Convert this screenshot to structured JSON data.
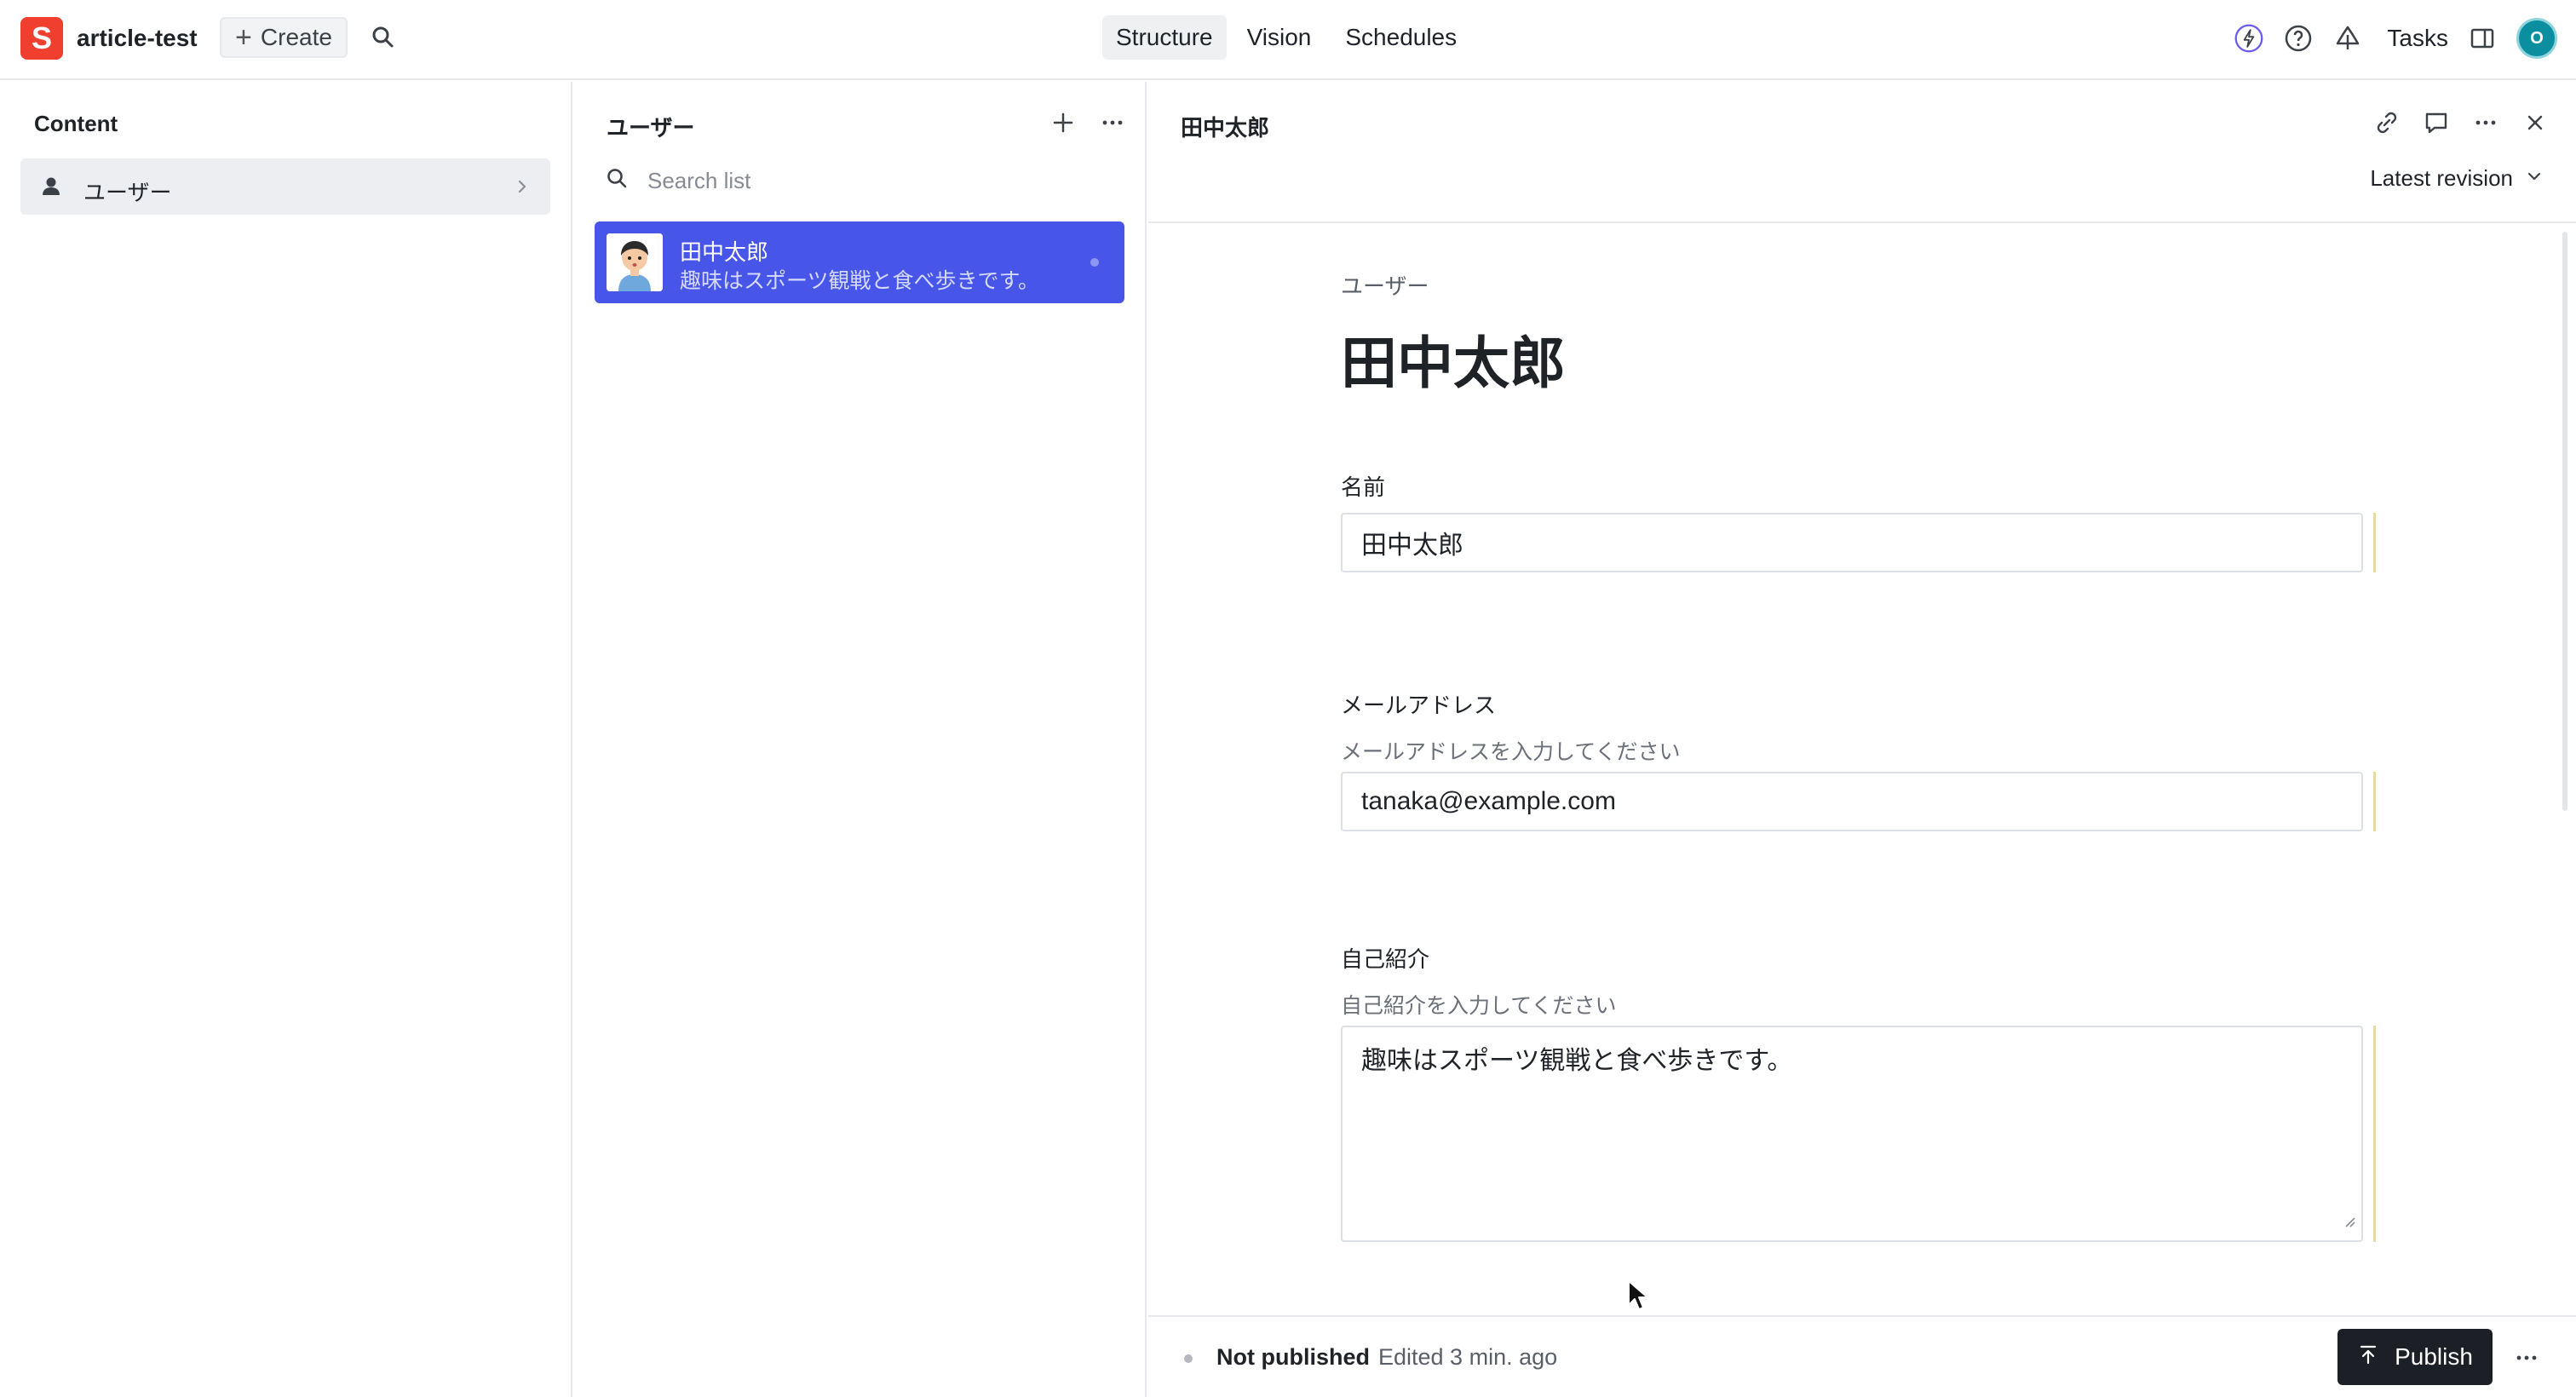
{
  "app": {
    "logo_letter": "S",
    "project_name": "article-test",
    "create_label": "Create",
    "nav_tabs": [
      "Structure",
      "Vision",
      "Schedules"
    ],
    "active_tab": "Structure",
    "tasks_label": "Tasks",
    "user_initial": "O",
    "brand_color": "#f03e2f"
  },
  "content_pane": {
    "title": "Content",
    "items": [
      {
        "label": "ユーザー",
        "icon": "person-icon"
      }
    ]
  },
  "list_pane": {
    "title": "ユーザー",
    "search_placeholder": "Search list",
    "documents": [
      {
        "title": "田中太郎",
        "subtitle": "趣味はスポーツ観戦と食べ歩きです。",
        "selected": true
      }
    ]
  },
  "document_pane": {
    "header_title": "田中太郎",
    "revision_label": "Latest revision",
    "doc_type": "ユーザー",
    "heading": "田中太郎",
    "fields": {
      "name": {
        "label": "名前",
        "value": "田中太郎"
      },
      "email": {
        "label": "メールアドレス",
        "description": "メールアドレスを入力してください",
        "value": "tanaka@example.com"
      },
      "bio": {
        "label": "自己紹介",
        "description": "自己紹介を入力してください",
        "value": "趣味はスポーツ観戦と食べ歩きです。"
      }
    },
    "footer": {
      "status": "Not published",
      "edited": "Edited 3 min. ago",
      "publish_label": "Publish"
    }
  }
}
